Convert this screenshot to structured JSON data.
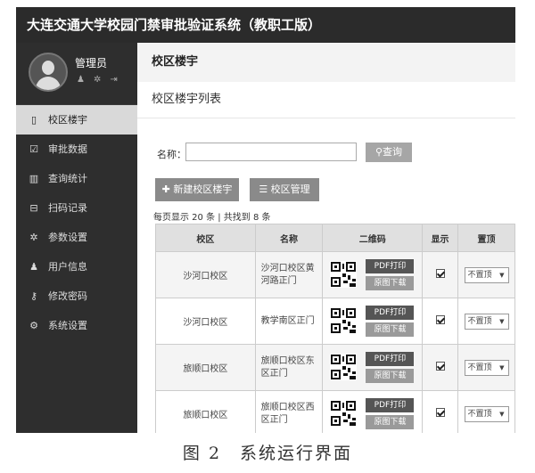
{
  "app": {
    "title": "大连交通大学校园门禁审批验证系统（教职工版）"
  },
  "user": {
    "name": "管理员",
    "icons": [
      "user-icon",
      "gear-icon",
      "logout-icon"
    ]
  },
  "sidebar": {
    "items": [
      {
        "label": "校区楼宇",
        "icon": "building-icon",
        "glyph": "▯",
        "active": true
      },
      {
        "label": "审批数据",
        "icon": "checkbox-icon",
        "glyph": "☑",
        "active": false
      },
      {
        "label": "查询统计",
        "icon": "bar-chart-icon",
        "glyph": "▥",
        "active": false
      },
      {
        "label": "扫码记录",
        "icon": "scan-icon",
        "glyph": "⊟",
        "active": false
      },
      {
        "label": "参数设置",
        "icon": "cog-icon",
        "glyph": "✲",
        "active": false
      },
      {
        "label": "用户信息",
        "icon": "person-icon",
        "glyph": "♟",
        "active": false
      },
      {
        "label": "修改密码",
        "icon": "key-icon",
        "glyph": "⚷",
        "active": false
      },
      {
        "label": "系统设置",
        "icon": "cogs-icon",
        "glyph": "⚙",
        "active": false
      }
    ]
  },
  "main": {
    "page_title": "校区楼宇",
    "panel_title": "校区楼宇列表",
    "search": {
      "label": "名称：",
      "value": "",
      "placeholder": "",
      "button": "查询"
    },
    "buttons": {
      "new": "新建校区楼宇",
      "manage": "校区管理"
    },
    "count_text": "每页显示 20 条 | 共找到 8 条",
    "table": {
      "headers": [
        "校区",
        "名称",
        "二维码",
        "显示",
        "置顶"
      ],
      "pdf_label": "PDF打印",
      "download_label": "原图下载",
      "rows": [
        {
          "campus": "沙河口校区",
          "name_lines": [
            "沙河口校区黄",
            "河路正门"
          ],
          "show": true,
          "top": "不置顶"
        },
        {
          "campus": "沙河口校区",
          "name_lines": [
            "教学南区正门"
          ],
          "show": true,
          "top": "不置顶"
        },
        {
          "campus": "旅顺口校区",
          "name_lines": [
            "旅顺口校区东",
            "区正门"
          ],
          "show": true,
          "top": "不置顶"
        },
        {
          "campus": "旅顺口校区",
          "name_lines": [
            "旅顺口校区西",
            "区正门"
          ],
          "show": true,
          "top": "不置顶"
        }
      ]
    }
  },
  "caption": "图 2　系统运行界面"
}
